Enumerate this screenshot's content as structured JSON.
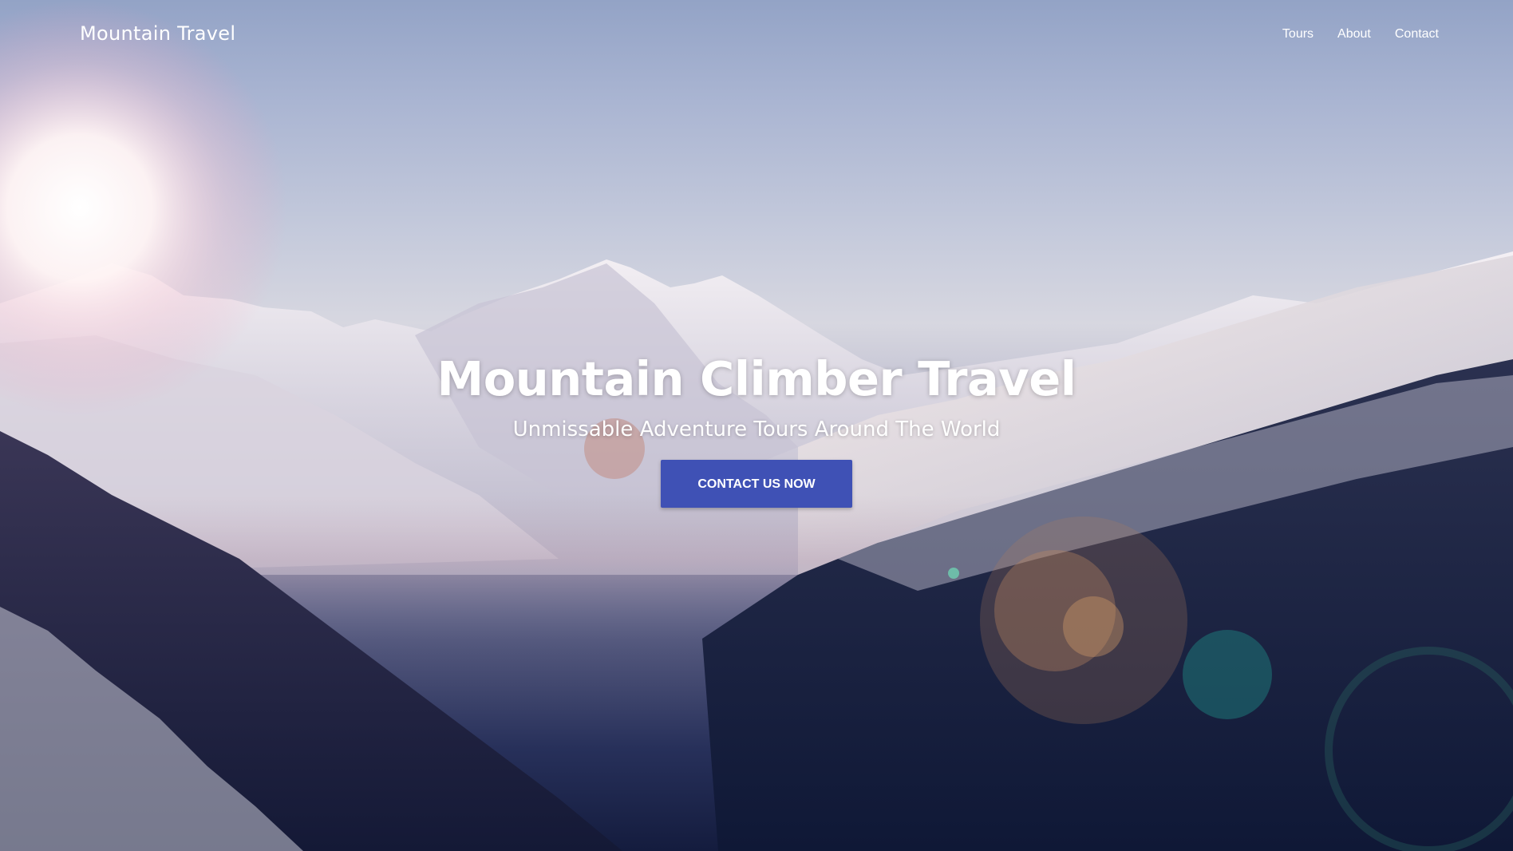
{
  "header": {
    "brand": "Mountain Travel",
    "nav": [
      {
        "label": "Tours"
      },
      {
        "label": "About"
      },
      {
        "label": "Contact"
      }
    ]
  },
  "hero": {
    "title": "Mountain Climber Travel",
    "subtitle": "Unmissable Adventure Tours Around The World",
    "cta_label": "CONTACT US NOW",
    "background": "snowy-mountain-valley-sunrise-photo"
  },
  "colors": {
    "accent": "#3f51b5",
    "text": "#ffffff"
  }
}
